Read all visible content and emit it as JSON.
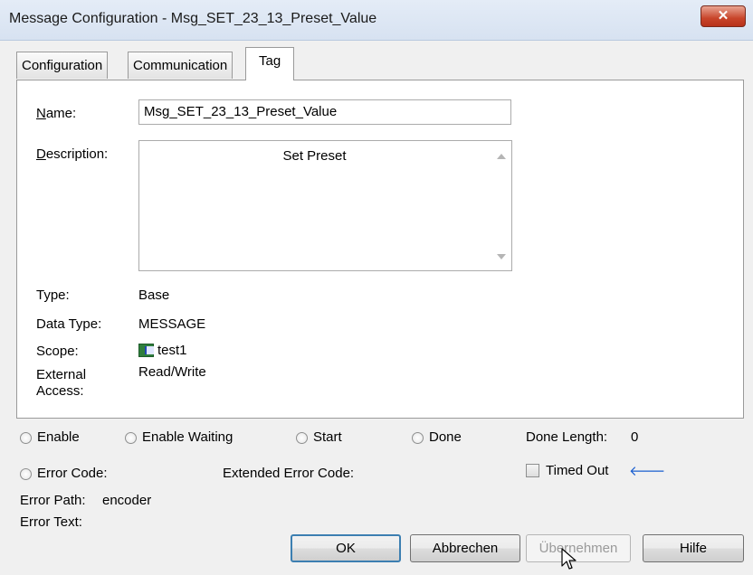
{
  "window": {
    "title": "Message Configuration - Msg_SET_23_13_Preset_Value",
    "close_glyph": "✕"
  },
  "tabs": [
    {
      "label": "Configuration"
    },
    {
      "label": "Communication"
    },
    {
      "label": "Tag",
      "active": true
    }
  ],
  "tag": {
    "name_label_mnemonic": "N",
    "name_label_rest": "ame:",
    "name_value": "Msg_SET_23_13_Preset_Value",
    "description_label_mnemonic": "D",
    "description_label_rest": "escription:",
    "description_value": "Set Preset",
    "type_label": "Type:",
    "type_value": "Base",
    "data_type_label": "Data Type:",
    "data_type_value": "MESSAGE",
    "scope_label": "Scope:",
    "scope_value": "test1",
    "scope_icon": "controller-icon",
    "external_access_label_1": "External",
    "external_access_label_2": "Access:",
    "external_access_value": "Read/Write"
  },
  "status": {
    "enable": "Enable",
    "enable_waiting": "Enable Waiting",
    "start": "Start",
    "done": "Done",
    "done_length_label": "Done Length:",
    "done_length_value": "0",
    "error_code": "Error Code:",
    "extended_error_code": "Extended Error Code:",
    "timed_out": "Timed Out",
    "timed_out_arrow": "🡐",
    "error_path_label": "Error Path:",
    "error_path_value": "encoder",
    "error_text_label": "Error Text:"
  },
  "buttons": {
    "ok": "OK",
    "cancel": "Abbrechen",
    "apply": "Übernehmen",
    "help": "Hilfe"
  },
  "colors": {
    "title_bar": "#dbe5f3",
    "close_button": "#c8452b",
    "panel_bg": "#ffffff",
    "dialog_bg": "#f0f0f0"
  }
}
